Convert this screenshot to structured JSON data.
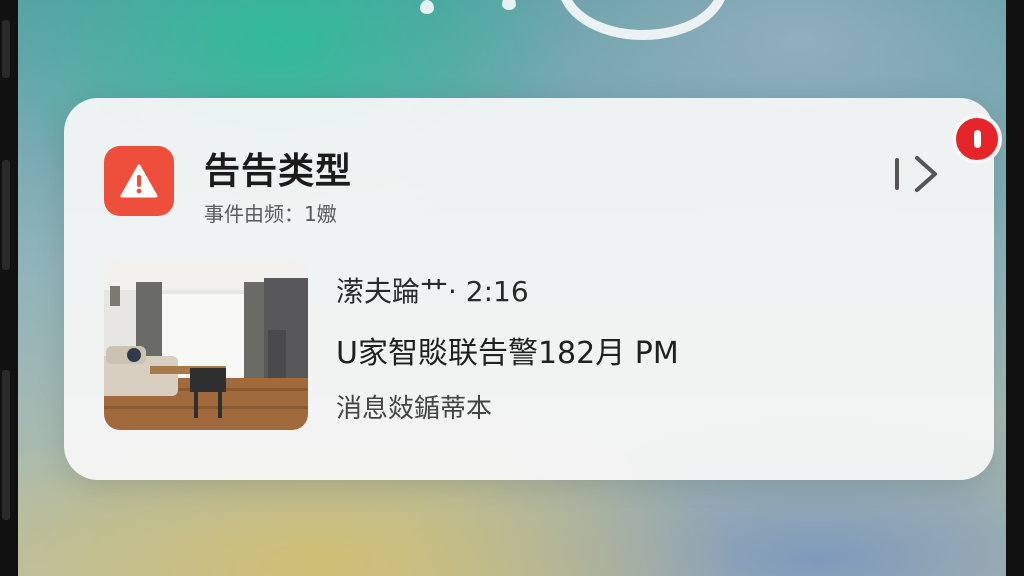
{
  "notification": {
    "title": "告告类型",
    "subtitle": "事件由频：1嫐",
    "meta_line": "潆夫踚艹· 2:16",
    "body_line": "U家智賧联告警182月 PM",
    "detail_line": "消息敥鍎蒂本",
    "app_icon": "warning-triangle-icon",
    "open_icon": "chevron-right-icon",
    "badge_icon": "alert-badge-icon",
    "thumbnail": "living-room-camera-snapshot"
  },
  "colors": {
    "app_icon_bg": "#ee4f3c",
    "badge_bg": "#e5252a",
    "card_bg": "#f7f8f7"
  }
}
